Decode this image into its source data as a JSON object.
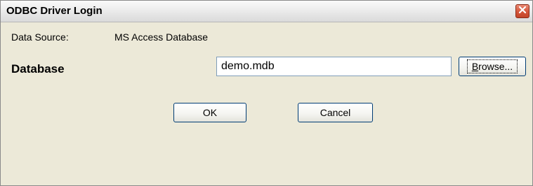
{
  "window": {
    "title": "ODBC Driver Login"
  },
  "form": {
    "data_source_label": "Data Source:",
    "data_source_value": "MS Access Database",
    "database_label": "Database",
    "database_value": "demo.mdb"
  },
  "buttons": {
    "browse_first": "B",
    "browse_rest": "rowse...",
    "ok": "OK",
    "cancel": "Cancel"
  },
  "icons": {
    "close": "close-icon"
  },
  "colors": {
    "dialog_bg": "#ece9d8",
    "close_button": "#d4553a",
    "button_border": "#003c74"
  }
}
